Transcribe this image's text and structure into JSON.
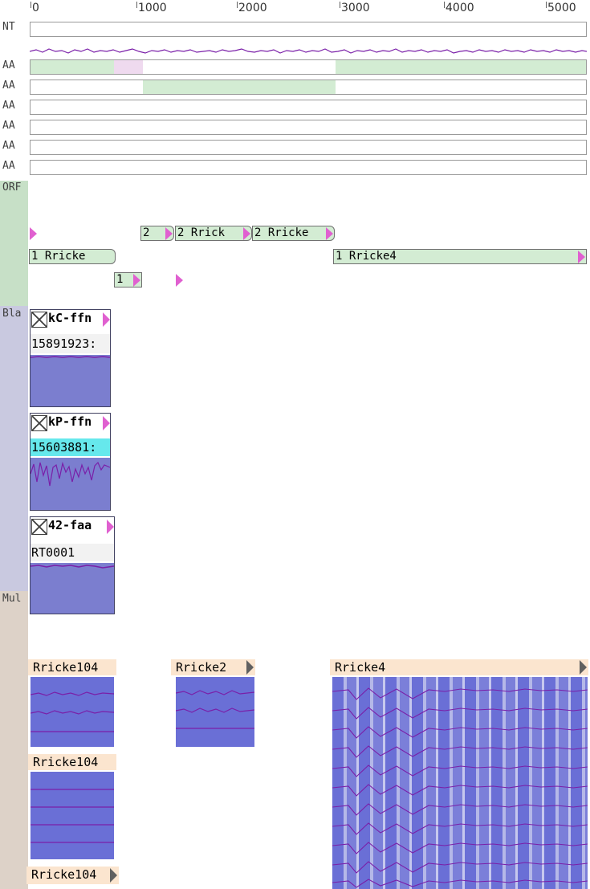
{
  "ruler": {
    "ticks": [
      "0",
      "1000",
      "2000",
      "3000",
      "4000",
      "5000"
    ]
  },
  "rows": {
    "nt_label": "NT",
    "aa_labels": [
      "AA",
      "AA",
      "AA",
      "AA",
      "AA",
      "AA"
    ],
    "orf_label": "ORF",
    "blast_label": "Bla",
    "multi_label": "Mul"
  },
  "orf_features": {
    "row1": [
      "2",
      "2 Rrick",
      "2 Rricke"
    ],
    "row2": [
      "1 Rricke",
      "1 Rricke4"
    ],
    "row3": [
      "1"
    ]
  },
  "blast_cards": [
    {
      "title": "kC-ffn",
      "subtitle": "15891923:"
    },
    {
      "title": "kP-ffn",
      "subtitle": "15603881:"
    },
    {
      "title": "42-faa",
      "subtitle": "RT0001"
    }
  ],
  "multi_alignments": [
    "Rricke104",
    "Rricke2",
    "Rricke4",
    "Rricke104",
    "Rricke104"
  ],
  "colors": {
    "orf_green": "#d3ecd3",
    "blast_blue": "#7b7ecf",
    "msa_blue": "#6a6fd6",
    "highlight_cyan": "#66e8ec",
    "label_peach": "#fbe5cf",
    "marker_pink": "#e060d0",
    "line_purple": "#7a1fa8"
  }
}
